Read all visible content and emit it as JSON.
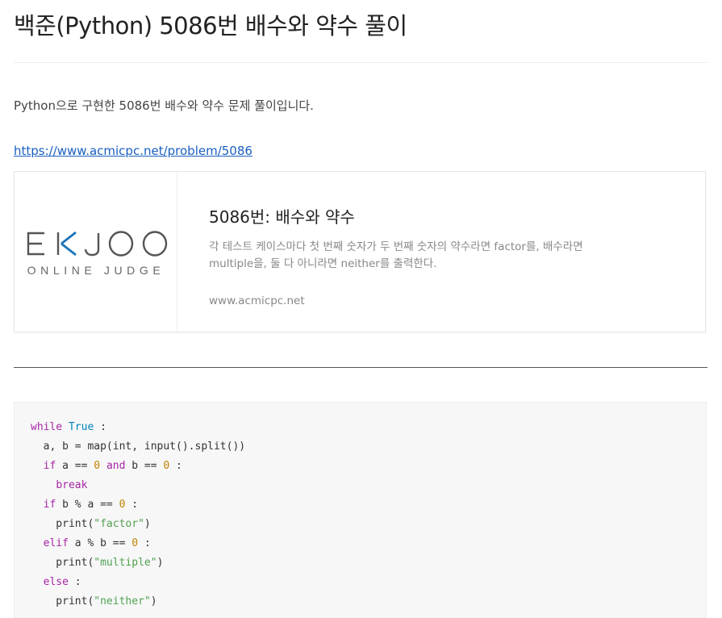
{
  "post": {
    "title": "백준(Python) 5086번 배수와 약수 풀이",
    "intro": "Python으로 구현한 5086번 배수와 약수 문제 풀이입니다.",
    "link_text": "https://www.acmicpc.net/problem/5086"
  },
  "link_card": {
    "logo": {
      "mark": "EKJOO",
      "tagline": "ONLINE JUDGE",
      "accent_color": "#1a75bb",
      "text_color": "#555555"
    },
    "title": "5086번: 배수와 약수",
    "description": "각 테스트 케이스마다 첫 번째 숫자가 두 번째 숫자의 약수라면 factor를, 배수라면 multiple을, 둘 다 아니라면 neither를 출력한다.",
    "host": "www.acmicpc.net"
  },
  "code": {
    "lines": [
      [
        {
          "t": "kw",
          "v": "while"
        },
        {
          "t": "",
          "v": " "
        },
        {
          "t": "bi",
          "v": "True"
        },
        {
          "t": "",
          "v": " :"
        }
      ],
      [
        {
          "t": "",
          "v": "  a, b = map(int, input().split())"
        }
      ],
      [
        {
          "t": "",
          "v": "  "
        },
        {
          "t": "kw",
          "v": "if"
        },
        {
          "t": "",
          "v": " a == "
        },
        {
          "t": "num",
          "v": "0"
        },
        {
          "t": "",
          "v": " "
        },
        {
          "t": "kw",
          "v": "and"
        },
        {
          "t": "",
          "v": " b == "
        },
        {
          "t": "num",
          "v": "0"
        },
        {
          "t": "",
          "v": " :"
        }
      ],
      [
        {
          "t": "",
          "v": "    "
        },
        {
          "t": "kw",
          "v": "break"
        }
      ],
      [
        {
          "t": "",
          "v": "  "
        },
        {
          "t": "kw",
          "v": "if"
        },
        {
          "t": "",
          "v": " b % a == "
        },
        {
          "t": "num",
          "v": "0"
        },
        {
          "t": "",
          "v": " :"
        }
      ],
      [
        {
          "t": "",
          "v": "    print("
        },
        {
          "t": "str",
          "v": "\"factor\""
        },
        {
          "t": "",
          "v": ")"
        }
      ],
      [
        {
          "t": "",
          "v": "  "
        },
        {
          "t": "kw",
          "v": "elif"
        },
        {
          "t": "",
          "v": " a % b == "
        },
        {
          "t": "num",
          "v": "0"
        },
        {
          "t": "",
          "v": " :"
        }
      ],
      [
        {
          "t": "",
          "v": "    print("
        },
        {
          "t": "str",
          "v": "\"multiple\""
        },
        {
          "t": "",
          "v": ")"
        }
      ],
      [
        {
          "t": "",
          "v": "  "
        },
        {
          "t": "kw",
          "v": "else"
        },
        {
          "t": "",
          "v": " :"
        }
      ],
      [
        {
          "t": "",
          "v": "    print("
        },
        {
          "t": "str",
          "v": "\"neither\""
        },
        {
          "t": "",
          "v": ")"
        }
      ]
    ]
  }
}
